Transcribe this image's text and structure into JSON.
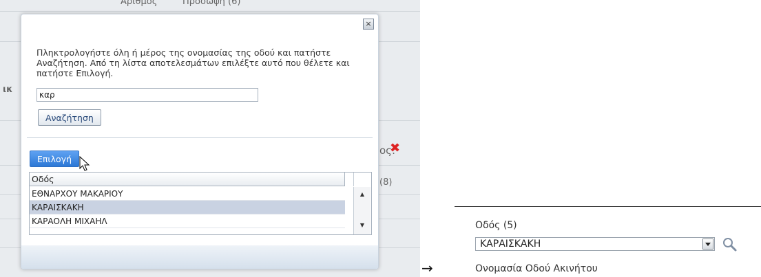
{
  "background": {
    "top_texts": [
      "Αριθμός",
      "Πρόσωψη (6)"
    ],
    "side_fragment_left": "ικ",
    "side_fragment_right": "ος:",
    "count_fragment": "(8)"
  },
  "dialog": {
    "close_label": "×",
    "instructions": "Πληκτρολογήστε όλη ή μέρος της ονομασίας της οδού και πατήστε Αναζήτηση. Από τη λίστα αποτελεσμάτων επιλέξτε αυτό που θέλετε και πατήστε Επιλογή.",
    "search_value": "καρ",
    "search_button_label": "Αναζήτηση",
    "select_button_label": "Επιλογή",
    "grid": {
      "header": "Οδός",
      "rows": [
        "ΕΘΝΑΡΧΟΥ ΜΑΚΑΡΙΟΥ",
        "ΚΑΡΑΙΣΚΑΚΗ",
        "ΚΑΡΑΟΛΗ ΜΙΧΑΗΛ"
      ],
      "selected_index": 1
    }
  },
  "flow_arrow": "→",
  "result_field": {
    "label": "Οδός (5)",
    "value": "ΚΑΡΑΙΣΚΑΚΗ",
    "sub_label": "Ονομασία Οδού Ακινήτου"
  },
  "icons": {
    "close": "close-icon",
    "cursor": "cursor-icon",
    "search": "search-icon"
  }
}
